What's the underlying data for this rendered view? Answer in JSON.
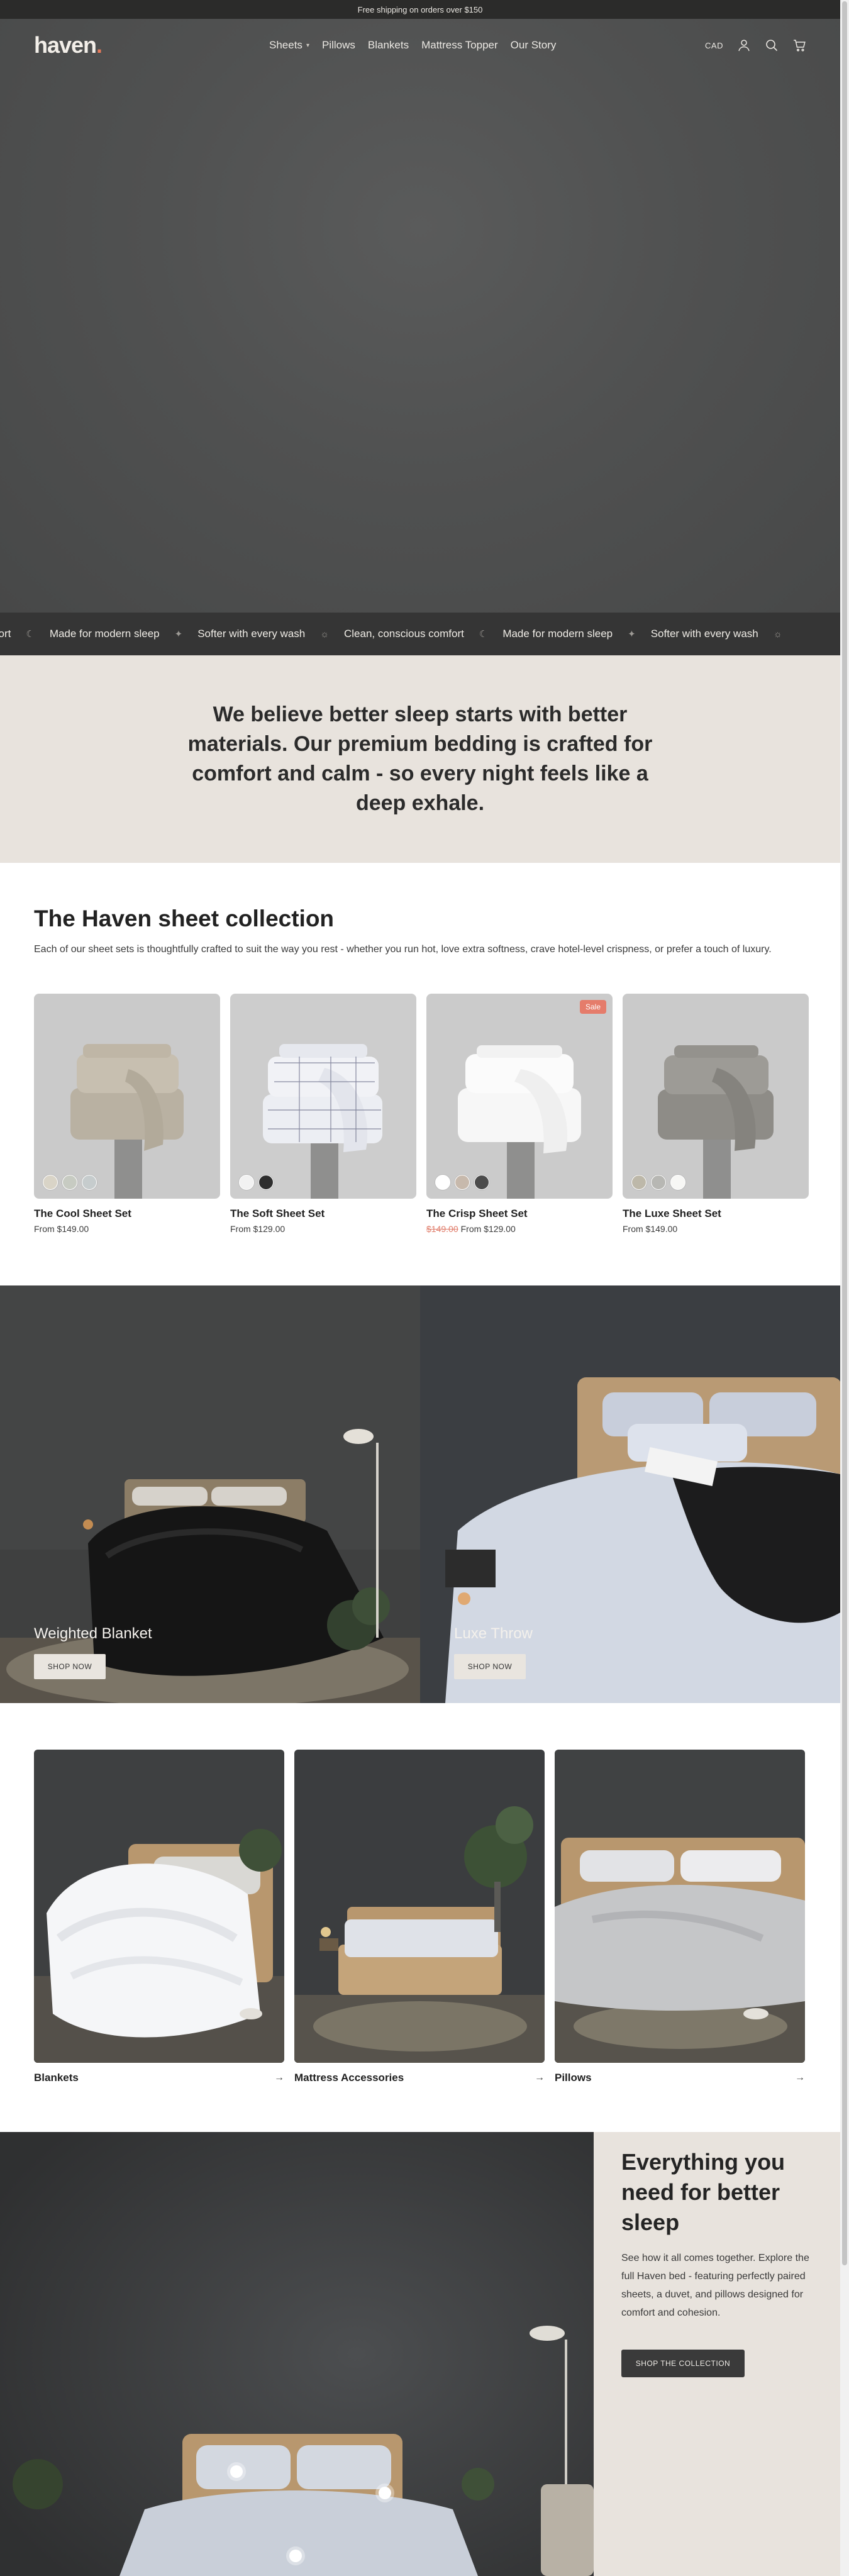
{
  "announcement": "Free shipping on orders over $150",
  "nav": {
    "logo": "haven",
    "logo_dot": ".",
    "items": [
      {
        "label": "Sheets",
        "dropdown": true
      },
      {
        "label": "Pillows"
      },
      {
        "label": "Blankets"
      },
      {
        "label": "Mattress Topper"
      },
      {
        "label": "Our Story"
      }
    ],
    "currency": "CAD",
    "icons": [
      "account-icon",
      "search-icon",
      "cart-icon"
    ]
  },
  "marquee": {
    "items": [
      "us comfort",
      "Made for modern sleep",
      "Softer with every wash",
      "Clean, conscious comfort",
      "Made for modern sleep",
      "Softer with every wash"
    ],
    "separator_icon": "moon-icon"
  },
  "belief": "We believe better sleep starts with better materials. Our premium bedding is crafted for comfort and calm - so every night feels like a deep exhale.",
  "collection": {
    "title": "The Haven sheet collection",
    "description": "Each of our sheet sets is thoughtfully crafted to suit the way you rest - whether you run hot, love extra softness, crave hotel-level crispness, or prefer a touch of luxury.",
    "products": [
      {
        "name": "The Cool Sheet Set",
        "price": "From $149.00",
        "swatches": [
          "#d9d4c7",
          "#c7cbc2",
          "#c6cccd"
        ]
      },
      {
        "name": "The Soft Sheet Set",
        "price": "From $129.00",
        "swatches": [
          "#f2f2f2",
          "#2e2e2e"
        ]
      },
      {
        "name": "The Crisp Sheet Set",
        "compare_price": "$149.00",
        "price": "From $129.00",
        "badge": "Sale",
        "swatches": [
          "#ffffff",
          "#c7b9ac",
          "#4b4b4b"
        ]
      },
      {
        "name": "The Luxe Sheet Set",
        "price": "From $149.00",
        "swatches": [
          "#bdb8a9",
          "#b7b7b3",
          "#f7f7f5"
        ]
      }
    ]
  },
  "banners": [
    {
      "label": "Weighted Blanket",
      "button": "SHOP NOW"
    },
    {
      "label": "Luxe Throw",
      "button": "SHOP NOW"
    }
  ],
  "categories": [
    {
      "name": "Blankets"
    },
    {
      "name": "Mattress Accessories"
    },
    {
      "name": "Pillows"
    }
  ],
  "everything": {
    "title": "Everything you need for better sleep",
    "description": "See how it all comes together. Explore the full Haven bed - featuring perfectly paired sheets, a duvet, and pillows designed for comfort and cohesion.",
    "button": "SHOP THE COLLECTION"
  }
}
